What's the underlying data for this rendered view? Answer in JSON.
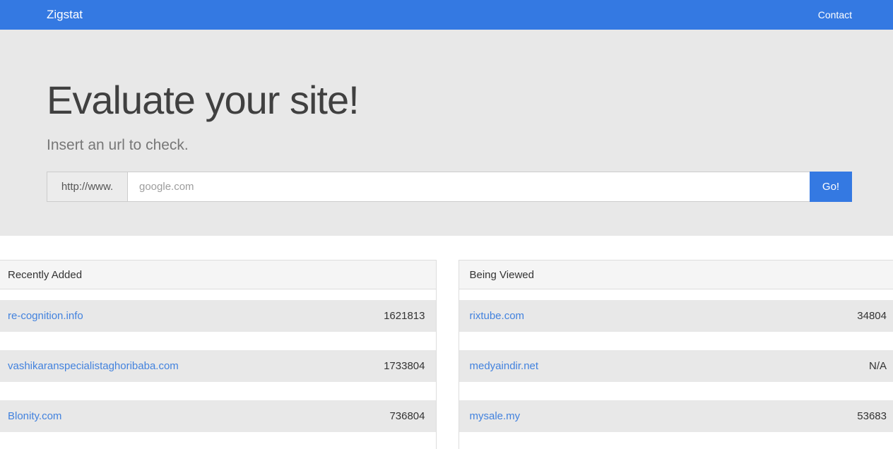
{
  "theme": {
    "primary_color": "#3479e2",
    "link_color": "#4282de",
    "stripe_color": "#e8e8e8",
    "panel_heading_color": "#f5f5f5"
  },
  "navbar": {
    "brand": "Zigstat",
    "contact_label": "Contact"
  },
  "hero": {
    "title": "Evaluate your site!",
    "subtitle": "Insert an url to check.",
    "url_prefix": "http://www.",
    "input_placeholder": "google.com",
    "input_value": "",
    "go_label": "Go!"
  },
  "panels": [
    {
      "title": "Recently Added",
      "rows": [
        {
          "site": "re-cognition.info",
          "value": "1621813"
        },
        {
          "site": "vashikaranspecialistaghoribaba.com",
          "value": "1733804"
        },
        {
          "site": "Blonity.com",
          "value": "736804"
        }
      ]
    },
    {
      "title": "Being Viewed",
      "rows": [
        {
          "site": "rixtube.com",
          "value": "34804"
        },
        {
          "site": "medyaindir.net",
          "value": "N/A"
        },
        {
          "site": "mysale.my",
          "value": "53683"
        }
      ]
    }
  ]
}
